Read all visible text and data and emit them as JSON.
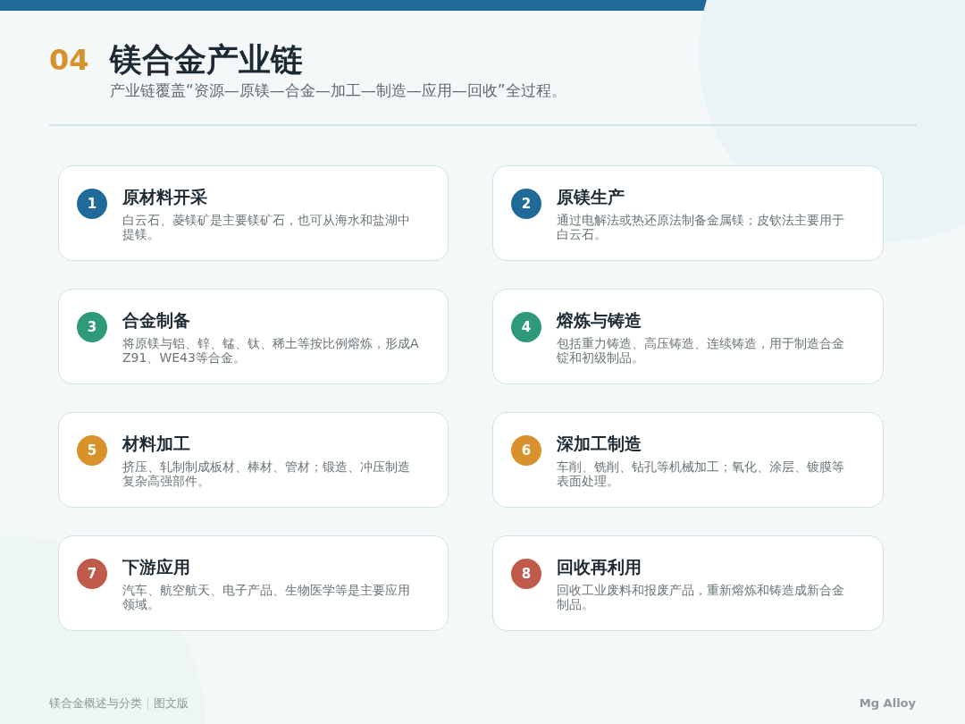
{
  "header": {
    "number": "04",
    "title": "镁合金产业链",
    "subtitle": "产业链覆盖“资源—原镁—合金—加工—制造—应用—回收”全过程。"
  },
  "steps": [
    {
      "number": "1",
      "title": "原材料开采",
      "description": "白云石、菱镁矿是主要镁矿石，也可从海水和盐湖中提镁。",
      "color": "#1f6a99"
    },
    {
      "number": "2",
      "title": "原镁生产",
      "description": "通过电解法或热还原法制备金属镁；皮钦法主要用于白云石。",
      "color": "#1f6a99"
    },
    {
      "number": "3",
      "title": "合金制备",
      "description": "将原镁与铝、锌、锰、钛、稀土等按比例熔炼，形成AZ91、WE43等合金。",
      "color": "#2e9a7a"
    },
    {
      "number": "4",
      "title": "熔炼与铸造",
      "description": "包括重力铸造、高压铸造、连续铸造，用于制造合金锭和初级制品。",
      "color": "#2e9a7a"
    },
    {
      "number": "5",
      "title": "材料加工",
      "description": "挤压、轧制制成板材、棒材、管材；锻造、冲压制造复杂高强部件。",
      "color": "#d9922b"
    },
    {
      "number": "6",
      "title": "深加工制造",
      "description": "车削、铣削、钻孔等机械加工；氧化、涂层、镀膜等表面处理。",
      "color": "#d9922b"
    },
    {
      "number": "7",
      "title": "下游应用",
      "description": "汽车、航空航天、电子产品、生物医学等是主要应用领域。",
      "color": "#c05a4a"
    },
    {
      "number": "8",
      "title": "回收再利用",
      "description": "回收工业废料和报废产品，重新熔炼和铸造成新合金制品。",
      "color": "#c05a4a"
    }
  ],
  "footer": {
    "left": [
      "镁合金概述与分类",
      "图文版"
    ],
    "right": "Mg Alloy"
  }
}
